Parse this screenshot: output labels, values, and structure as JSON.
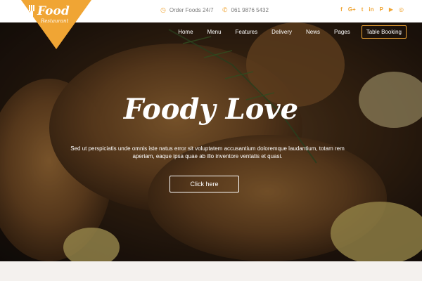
{
  "logo": {
    "title": "Food",
    "subtitle": "Restaurant"
  },
  "topbar": {
    "order_text": "Order Foods 24/7",
    "phone_text": "061 9876 5432",
    "socials": [
      "f",
      "G+",
      "t",
      "in",
      "P",
      "▶",
      "◎"
    ]
  },
  "nav": {
    "items": [
      "Home",
      "Menu",
      "Features",
      "Delivery",
      "News",
      "Pages"
    ],
    "booking": "Table Booking"
  },
  "hero": {
    "title": "Foody Love",
    "text": "Sed ut perspiciatis unde omnis iste natus error sit voluptatem accusantium doloremque laudantium, totam rem aperiam, eaque ipsa quae ab illo inventore ventatis et quasi.",
    "button": "Click here"
  },
  "colors": {
    "accent": "#f0a534"
  },
  "icons": {
    "order": "clock-icon",
    "phone": "phone-icon"
  }
}
